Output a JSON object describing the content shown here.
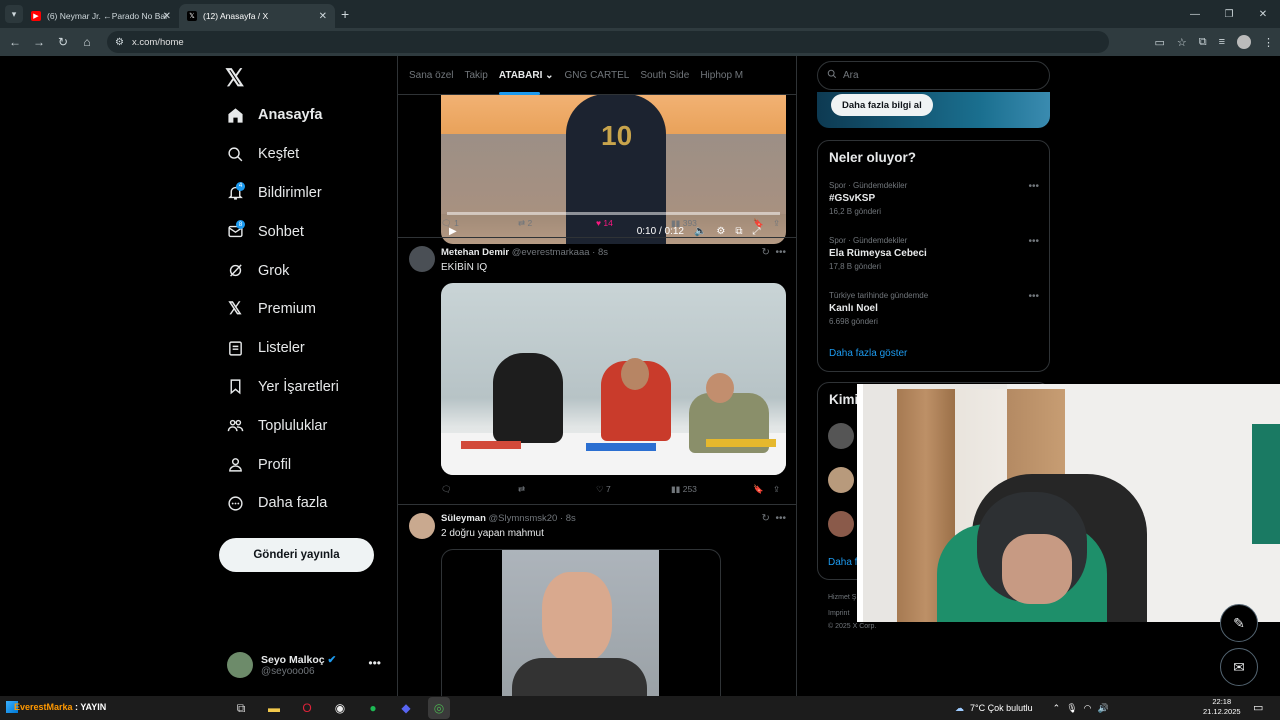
{
  "browser": {
    "tabs": [
      {
        "title": "(6) Neymar Jr. ←Parado No Bai",
        "favicon": "youtube-icon",
        "color": "#ff0000"
      },
      {
        "title": "(12) Anasayfa / X",
        "favicon": "x-icon",
        "color": "#000000"
      }
    ],
    "url": "x.com/home"
  },
  "sidebar": {
    "items": [
      {
        "label": "Anasayfa",
        "icon": "home-icon"
      },
      {
        "label": "Keşfet",
        "icon": "search-icon"
      },
      {
        "label": "Bildirimler",
        "icon": "bell-icon",
        "badge": "4"
      },
      {
        "label": "Sohbet",
        "icon": "mail-icon",
        "badge": "8"
      },
      {
        "label": "Grok",
        "icon": "grok-icon"
      },
      {
        "label": "Premium",
        "icon": "x-icon"
      },
      {
        "label": "Listeler",
        "icon": "list-icon"
      },
      {
        "label": "Yer İşaretleri",
        "icon": "bookmark-icon"
      },
      {
        "label": "Topluluklar",
        "icon": "communities-icon"
      },
      {
        "label": "Profil",
        "icon": "profile-icon"
      },
      {
        "label": "Daha fazla",
        "icon": "more-circle-icon"
      }
    ],
    "post_button": "Gönderi yayınla",
    "account": {
      "name": "Seyo Malkoç",
      "handle": "@seyooo06"
    }
  },
  "feed": {
    "tabs": [
      "Sana özel",
      "Takip",
      "ATABARI",
      "GNG CARTEL",
      "South Side",
      "Hiphop M"
    ],
    "active_tab": "ATABARI",
    "video": {
      "jersey": "10",
      "time": "0:10 / 0:12"
    },
    "post0_stats": {
      "replies": "1",
      "reposts": "2",
      "likes": "14",
      "views": "393"
    },
    "post1": {
      "name": "Metehan Demir",
      "handle": "@everestmarkaaa",
      "time": "· 8s",
      "text": "EKİBİN IQ",
      "stats": {
        "replies": "",
        "reposts": "",
        "likes": "7",
        "views": "253"
      }
    },
    "post2": {
      "name": "Süleyman",
      "handle": "@Slymnsmsk20",
      "time": "· 8s",
      "text": "2 doğru yapan mahmut"
    }
  },
  "right": {
    "search_placeholder": "Ara",
    "promo_button": "Daha fazla bilgi al",
    "trends_title": "Neler oluyor?",
    "trends": [
      {
        "context": "Spor · Gündemdekiler",
        "name": "#GSvKSP",
        "count": "16,2 B gönderi"
      },
      {
        "context": "Spor · Gündemdekiler",
        "name": "Ela Rümeysa Cebeci",
        "count": "17,8 B gönderi"
      },
      {
        "context": "Türkiye tarihinde gündemde",
        "name": "Kanlı Noel",
        "count": "6.698 gönderi"
      }
    ],
    "show_more": "Daha fazla göster",
    "who_title": "Kimi",
    "who_more": "Daha f",
    "footer": [
      "Hizmet Ş",
      "Imprint",
      "© 2025 X Corp."
    ]
  },
  "taskbar": {
    "stream_prefix": "EverestMarka",
    "stream_suffix": " : YAYIN",
    "weather": "7°C  Çok bulutlu",
    "time": "22:18",
    "date": "21.12.2025"
  },
  "colors": {
    "accent": "#1d9bf0",
    "like": "#f91880",
    "background": "#000000"
  }
}
